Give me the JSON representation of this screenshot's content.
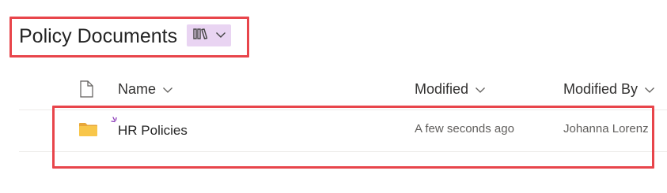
{
  "library": {
    "title": "Policy Documents",
    "view_switcher_icon": "library-books-icon"
  },
  "columns": {
    "file_type_icon": "document-icon",
    "name": "Name",
    "modified": "Modified",
    "modified_by": "Modified By"
  },
  "rows": [
    {
      "type_icon": "folder-icon",
      "name": "HR Policies",
      "is_new": true,
      "modified": "A few seconds ago",
      "modified_by": "Johanna Lorenz"
    }
  ],
  "colors": {
    "highlight_box": "#e8454b",
    "view_switcher_bg": "#e9d4f2",
    "folder": "#f8c64a",
    "new_indicator": "#8a3ab8"
  }
}
